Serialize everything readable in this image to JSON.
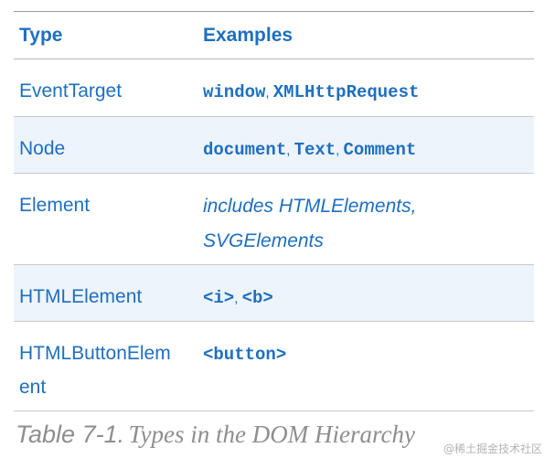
{
  "table": {
    "headers": [
      "Type",
      "Examples"
    ],
    "rows": [
      {
        "type_line1": "EventTarget",
        "type_line2": "",
        "examples": [
          {
            "text": "window",
            "code": true
          },
          {
            "text": ", ",
            "code": false
          },
          {
            "text": "XMLHttpRequest",
            "code": true
          }
        ]
      },
      {
        "type_line1": "Node",
        "type_line2": "",
        "examples": [
          {
            "text": "document",
            "code": true
          },
          {
            "text": ", ",
            "code": false
          },
          {
            "text": "Text",
            "code": true
          },
          {
            "text": ", ",
            "code": false
          },
          {
            "text": "Comment",
            "code": true
          }
        ]
      },
      {
        "type_line1": "Element",
        "type_line2": "",
        "examples_italic_line1": "includes HTMLElements,",
        "examples_italic_line2": "SVGElements"
      },
      {
        "type_line1": "HTMLElement",
        "type_line2": "",
        "examples": [
          {
            "text": "<i>",
            "code": true
          },
          {
            "text": ", ",
            "code": false
          },
          {
            "text": "<b>",
            "code": true
          }
        ]
      },
      {
        "type_line1": "HTMLButtonElem",
        "type_line2": "ent",
        "examples": [
          {
            "text": "<button>",
            "code": true
          }
        ]
      }
    ]
  },
  "caption": {
    "label": "Table 7-1.",
    "text": "Types in the DOM Hierarchy"
  },
  "watermark": "@稀土掘金技术社区"
}
